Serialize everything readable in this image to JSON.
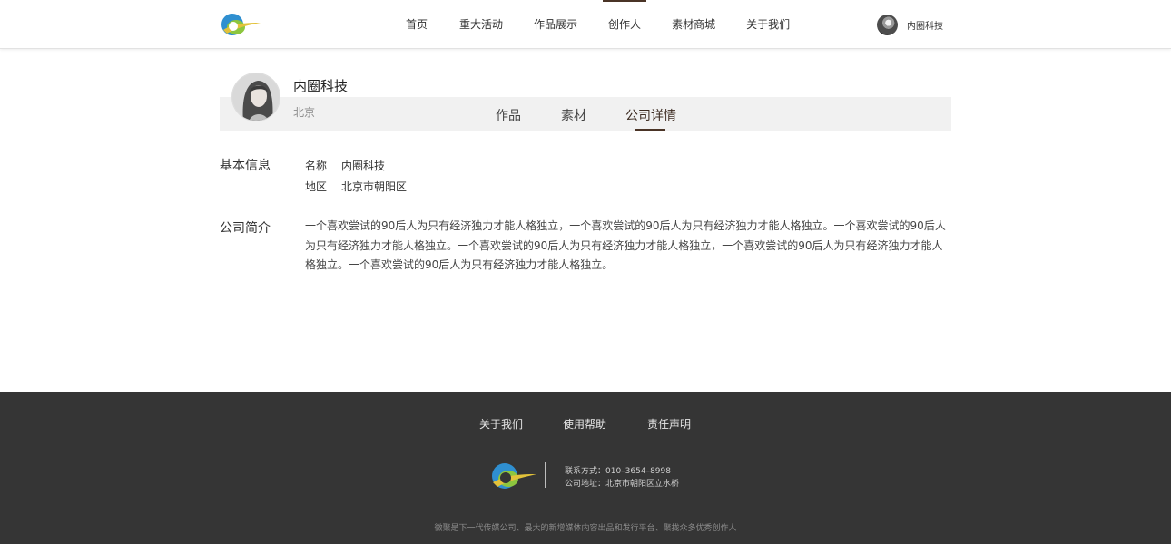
{
  "header": {
    "nav": [
      "首页",
      "重大活动",
      "作品展示",
      "创作人",
      "素材商城",
      "关于我们"
    ],
    "active_nav": "创作人",
    "user_name": "内圈科技"
  },
  "profile": {
    "name": "内圈科技",
    "city": "北京",
    "tabs": [
      "作品",
      "素材",
      "公司详情"
    ],
    "active_tab": "公司详情"
  },
  "basic_info": {
    "title": "基本信息",
    "rows": [
      {
        "label": "名称",
        "value": "内圈科技"
      },
      {
        "label": "地区",
        "value": "北京市朝阳区"
      }
    ]
  },
  "intro": {
    "title": "公司简介",
    "text": "一个喜欢尝试的90后人为只有经济独力才能人格独立，一个喜欢尝试的90后人为只有经济独力才能人格独立。一个喜欢尝试的90后人为只有经济独力才能人格独立。一个喜欢尝试的90后人为只有经济独力才能人格独立，一个喜欢尝试的90后人为只有经济独力才能人格独立。一个喜欢尝试的90后人为只有经济独力才能人格独立。"
  },
  "footer": {
    "links": [
      "关于我们",
      "使用帮助",
      "责任声明"
    ],
    "contact": "联系方式：010–3654–8998",
    "address": "公司地址：北京市朝阳区立水桥",
    "tagline": "微聚是下一代传媒公司、最大的新增媒体内容出品和发行平台、聚拢众多优秀创作人"
  },
  "colors": {
    "accent": "#4a3426",
    "footer_bg": "#353535",
    "profile_bar_bg": "#f1f1f1"
  }
}
